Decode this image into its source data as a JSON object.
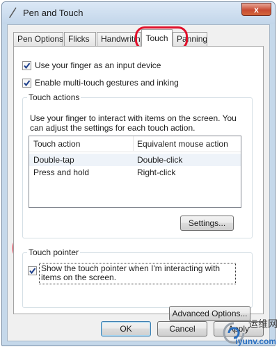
{
  "window": {
    "title": "Pen and Touch",
    "close_label": "x"
  },
  "tabs": [
    {
      "label": "Pen Options",
      "active": false
    },
    {
      "label": "Flicks",
      "active": false
    },
    {
      "label": "Handwriting",
      "active": false
    },
    {
      "label": "Touch",
      "active": true
    },
    {
      "label": "Panning",
      "active": false
    }
  ],
  "touch_panel": {
    "use_finger": {
      "label": "Use your finger as an input device",
      "checked": true
    },
    "multitouch": {
      "label": "Enable multi-touch gestures and inking",
      "checked": true
    },
    "touch_actions": {
      "title": "Touch actions",
      "description": "Use your finger to interact with items on the screen. You can adjust the settings for each touch action.",
      "columns": [
        "Touch action",
        "Equivalent mouse action"
      ],
      "rows": [
        [
          "Double-tap",
          "Double-click"
        ],
        [
          "Press and hold",
          "Right-click"
        ]
      ],
      "settings_button": "Settings..."
    },
    "touch_pointer": {
      "title": "Touch pointer",
      "show_pointer": {
        "label": "Show the touch pointer when I'm interacting with items on the screen.",
        "checked": true
      },
      "advanced_button": "Advanced Options..."
    }
  },
  "footer": {
    "ok": "OK",
    "cancel": "Cancel",
    "apply": "Apply"
  },
  "watermark": {
    "line1": "运维网",
    "line2": "iyunv.com"
  },
  "colors": {
    "annotation": "#e0102b",
    "titlebar": "#c3d6ea"
  }
}
